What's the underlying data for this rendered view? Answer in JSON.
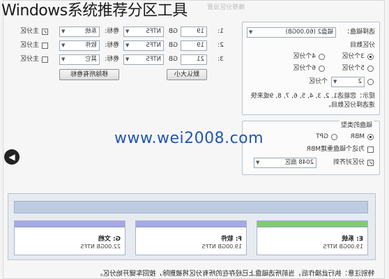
{
  "overlay_title": "Windows系统推荐分区工具",
  "watermark": "www.wei2008.com",
  "window": {
    "title": "推荐分区设置"
  },
  "select_disk": {
    "label": "选择磁盘：",
    "value": "磁盘2 (60.00GB)",
    "partition_count_label": "分区数目",
    "options": [
      "3个分区",
      "4个分区",
      "5个分区",
      "6个分区"
    ],
    "selected": "3个分区",
    "custom_value": "2",
    "custom_suffix": "个分区",
    "hint": "提示：您能选1, 2, 3, 4, 5, 6, 7, 8, 9或来快速选择分区数目。"
  },
  "disk_type": {
    "label": "磁盘的类型",
    "options": [
      "MBR",
      "GPT"
    ],
    "selected": "MBR",
    "rebuild_mbr": "为这个磁盘重建MBR",
    "align_label": "分区对齐到",
    "align_value": "2048 扇区"
  },
  "partitions": [
    {
      "num": "1:",
      "size": "19",
      "unit": "GB",
      "fs": "NTFS",
      "vol_label": "卷标:",
      "vol_value": "系统",
      "primary": "主分区",
      "primary_checked": true
    },
    {
      "num": "2:",
      "size": "19",
      "unit": "GB",
      "fs": "NTFS",
      "vol_label": "卷标:",
      "vol_value": "软件",
      "primary": "主分区",
      "primary_checked": false
    },
    {
      "num": "3:",
      "size": "21",
      "unit": "GB",
      "fs": "NTFS",
      "vol_label": "卷标:",
      "vol_value": "其它",
      "primary": "主分区",
      "primary_checked": false
    }
  ],
  "buttons": {
    "default_size": "默认大小",
    "remove_labels": "移除所有卷标"
  },
  "partition_map": {
    "cards": [
      {
        "name": "E: 系统",
        "info": "19.00GB NTFS",
        "color": "#7fcc6b"
      },
      {
        "name": "F: 软件",
        "info": "19.00GB NTFS",
        "color": "#a6a8e6"
      },
      {
        "name": "G: 文档",
        "info": "22.00GB NTFS",
        "color": "#a6a8e6"
      }
    ]
  },
  "footer_note": "特别注意：执行此操作后，当前所选磁盘上已经存在的所有分区将被删除，按回车键开始分区。"
}
